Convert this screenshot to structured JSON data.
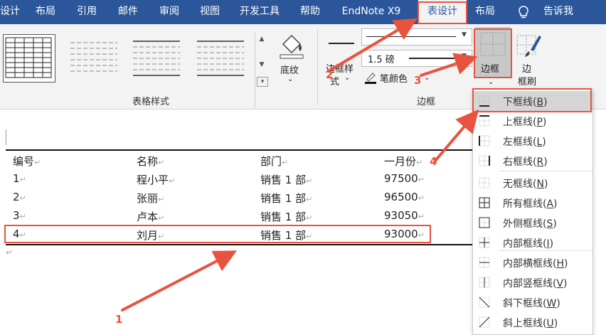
{
  "tabs": {
    "design_partial": "设计",
    "layout": "布局",
    "references": "引用",
    "mailings": "邮件",
    "review": "审阅",
    "view": "视图",
    "developer": "开发工具",
    "help": "帮助",
    "endnote": "EndNote X9",
    "table_design": "表设计",
    "table_layout": "布局",
    "tell_me": "告诉我"
  },
  "ribbon": {
    "table_styles_label": "表格样式",
    "shading_label": "底纹",
    "border_styles_line1": "边框样",
    "border_styles_line2": "式",
    "pen_weight": "1.5 磅",
    "pen_color": "笔颜色",
    "borders_label": "边框",
    "border_painter_line1": "边",
    "border_painter_line2": "框刷",
    "borders_group_label": "边框"
  },
  "table": {
    "headers": [
      "编号",
      "名称",
      "部门",
      "一月份"
    ],
    "rows": [
      [
        "1",
        "程小平",
        "销售 1 部",
        "97500"
      ],
      [
        "2",
        "张丽",
        "销售 1 部",
        "96500"
      ],
      [
        "3",
        "卢本",
        "销售 1 部",
        "93050"
      ],
      [
        "4",
        "刘月",
        "销售 1 部",
        "93000"
      ]
    ]
  },
  "menu": {
    "items": [
      {
        "label": "下框线(",
        "key": "B",
        "tail": ")",
        "icon": "bottom-border-icon"
      },
      {
        "label": "上框线(",
        "key": "P",
        "tail": ")",
        "icon": "top-border-icon"
      },
      {
        "label": "左框线(",
        "key": "L",
        "tail": ")",
        "icon": "left-border-icon"
      },
      {
        "label": "右框线(",
        "key": "R",
        "tail": ")",
        "icon": "right-border-icon"
      },
      {
        "label": "无框线(",
        "key": "N",
        "tail": ")",
        "icon": "no-border-icon"
      },
      {
        "label": "所有框线(",
        "key": "A",
        "tail": ")",
        "icon": "all-borders-icon"
      },
      {
        "label": "外侧框线(",
        "key": "S",
        "tail": ")",
        "icon": "outside-borders-icon"
      },
      {
        "label": "内部框线(",
        "key": "I",
        "tail": ")",
        "icon": "inside-borders-icon"
      },
      {
        "label": "内部横框线(",
        "key": "H",
        "tail": ")",
        "icon": "inside-horizontal-border-icon"
      },
      {
        "label": "内部竖框线(",
        "key": "V",
        "tail": ")",
        "icon": "inside-vertical-border-icon"
      },
      {
        "label": "斜下框线(",
        "key": "W",
        "tail": ")",
        "icon": "diagonal-down-border-icon"
      },
      {
        "label": "斜上框线(",
        "key": "U",
        "tail": ")",
        "icon": "diagonal-up-border-icon"
      }
    ]
  },
  "annotations": {
    "n1": "1",
    "n2": "2",
    "n3": "3",
    "n4": "4"
  },
  "colors": {
    "ribbon_blue": "#2b579a",
    "annotation_red": "#e8533f"
  }
}
